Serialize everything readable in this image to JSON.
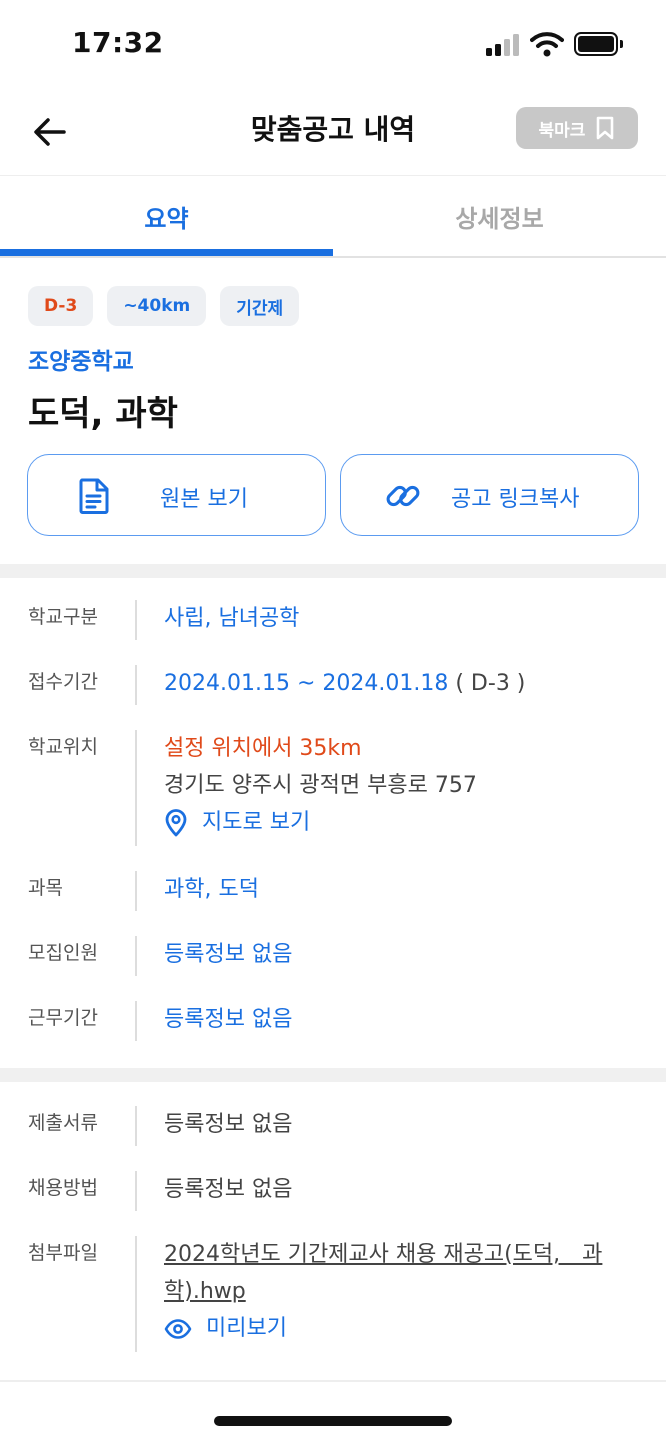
{
  "status_bar": {
    "time": "17:32"
  },
  "header": {
    "title": "맞춤공고 내역",
    "bookmark_label": "북마크"
  },
  "tabs": [
    {
      "label": "요약",
      "active": true
    },
    {
      "label": "상세정보",
      "active": false
    }
  ],
  "summary": {
    "badges": {
      "dday": "D-3",
      "distance": "~40km",
      "type": "기간제"
    },
    "school_name": "조양중학교",
    "subjects": "도덕, 과학",
    "buttons": {
      "original": "원본 보기",
      "copy_link": "공고 링크복사"
    }
  },
  "info": {
    "school_type": {
      "label": "학교구분",
      "value": "사립, 남녀공학"
    },
    "period": {
      "label": "접수기간",
      "value": "2024.01.15 ~ 2024.01.18",
      "suffix": "( D-3 )"
    },
    "location": {
      "label": "학교위치",
      "distance": "설정 위치에서 35km",
      "address": "경기도 양주시 광적면 부흥로 757",
      "map_link": "지도로 보기"
    },
    "subject": {
      "label": "과목",
      "value": "과학, 도덕"
    },
    "recruit": {
      "label": "모집인원",
      "value": "등록정보 없음"
    },
    "work_period": {
      "label": "근무기간",
      "value": "등록정보 없음"
    }
  },
  "extra": {
    "documents": {
      "label": "제출서류",
      "value": "등록정보 없음"
    },
    "method": {
      "label": "채용방법",
      "value": "등록정보 없음"
    },
    "attachment": {
      "label": "첨부파일",
      "file_line1": "2024학년도 기간제교사 채용 재공고(도덕,　과",
      "file_line2": "학).hwp",
      "preview": "미리보기"
    }
  },
  "colors": {
    "accent": "#1a6fe0",
    "warning": "#e04a1a",
    "bookmark_bg": "#c8c8c8"
  },
  "icons": [
    "back-arrow-icon",
    "bookmark-icon",
    "document-icon",
    "link-icon",
    "location-pin-icon",
    "eye-icon"
  ]
}
